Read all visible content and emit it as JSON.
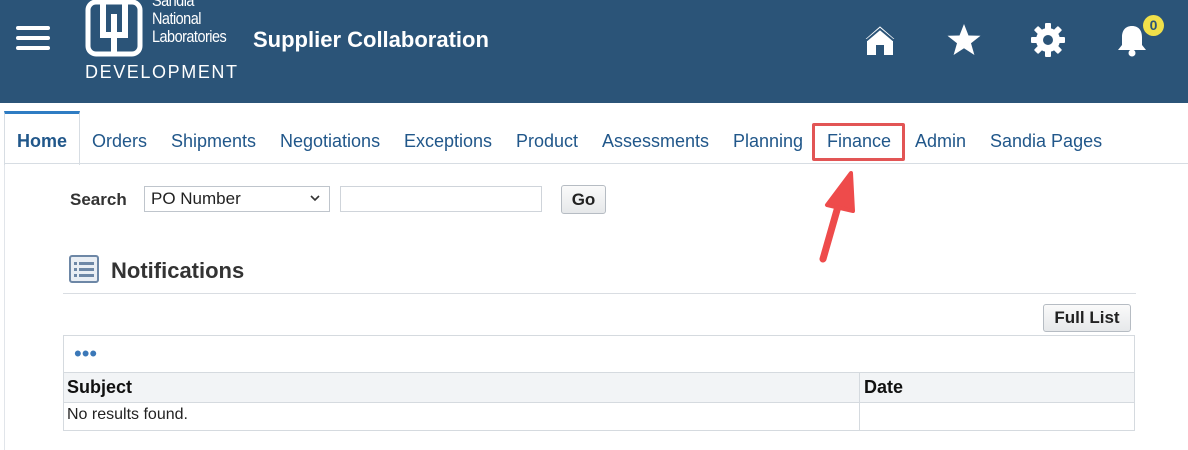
{
  "header": {
    "logo_lines": [
      "Sandia",
      "National",
      "Laboratories"
    ],
    "logo_env": "DEVELOPMENT",
    "app_title": "Supplier Collaboration",
    "notification_count": "0",
    "icons": [
      "menu-icon",
      "home-icon",
      "star-icon",
      "gear-icon",
      "bell-icon"
    ],
    "color": "#2b5478"
  },
  "tabs": [
    {
      "label": "Home",
      "active": true
    },
    {
      "label": "Orders"
    },
    {
      "label": "Shipments"
    },
    {
      "label": "Negotiations"
    },
    {
      "label": "Exceptions"
    },
    {
      "label": "Product"
    },
    {
      "label": "Assessments"
    },
    {
      "label": "Planning"
    },
    {
      "label": "Finance",
      "highlighted": true
    },
    {
      "label": "Admin"
    },
    {
      "label": "Sandia Pages"
    }
  ],
  "search": {
    "label": "Search",
    "selected_option": "PO Number",
    "input_value": "",
    "go_label": "Go"
  },
  "notifications": {
    "title": "Notifications",
    "full_list_label": "Full List",
    "more_label": "•••",
    "columns": [
      "Subject",
      "Date"
    ],
    "empty_message": "No results found."
  },
  "colors": {
    "link": "#21578a",
    "highlight": "#e25555",
    "badge": "#f0e04a"
  }
}
